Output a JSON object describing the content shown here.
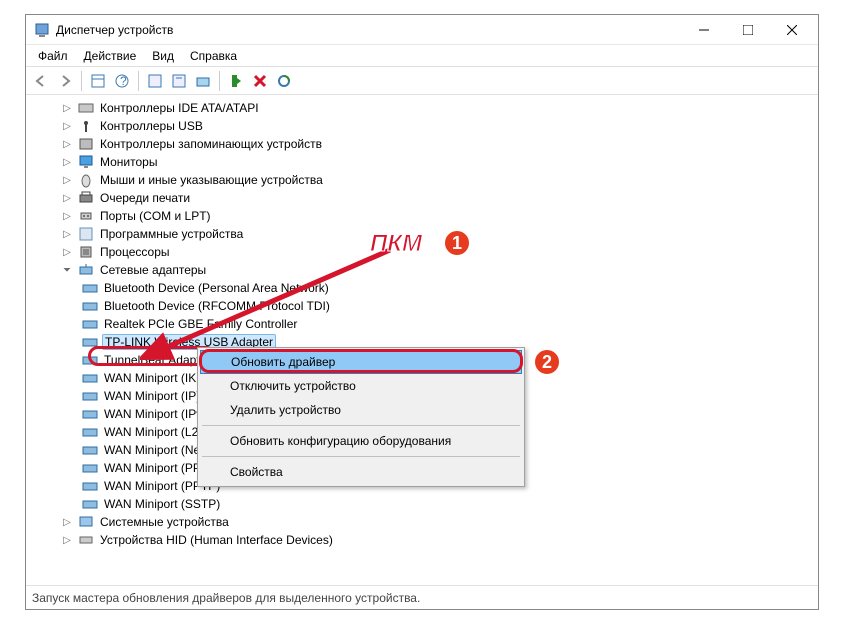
{
  "window": {
    "title": "Диспетчер устройств"
  },
  "menu": {
    "file": "Файл",
    "action": "Действие",
    "view": "Вид",
    "help": "Справка"
  },
  "categories": {
    "ide": "Контроллеры IDE ATA/ATAPI",
    "usb": "Контроллеры USB",
    "storage": "Контроллеры запоминающих устройств",
    "monitors": "Мониторы",
    "mice": "Мыши и иные указывающие устройства",
    "printqueues": "Очереди печати",
    "ports": "Порты (COM и LPT)",
    "software": "Программные устройства",
    "processors": "Процессоры",
    "network": "Сетевые адаптеры",
    "system": "Системные устройства",
    "hid": "Устройства HID (Human Interface Devices)"
  },
  "network_items": {
    "bt_pan": "Bluetooth Device (Personal Area Network)",
    "bt_rfcomm": "Bluetooth Device (RFCOMM Protocol TDI)",
    "realtek": "Realtek PCIe GBE Family Controller",
    "tplink": "TP-LINK Wireless USB Adapter",
    "tunnelbear": "TunnelBear Adapter V9",
    "wan_ike": "WAN Miniport (IKEv2)",
    "wan_ip": "WAN Miniport (IP)",
    "wan_ipv6": "WAN Miniport (IPv6)",
    "wan_l2tp": "WAN Miniport (L2TP)",
    "wan_netmon": "WAN Miniport (Network Monitor)",
    "wan_pppoe": "WAN Miniport (PPPOE)",
    "wan_pptp": "WAN Miniport (PPTP)",
    "wan_sstp": "WAN Miniport (SSTP)"
  },
  "context_menu": {
    "update": "Обновить драйвер",
    "disable": "Отключить устройство",
    "uninstall": "Удалить устройство",
    "scan": "Обновить конфигурацию оборудования",
    "properties": "Свойства"
  },
  "status": "Запуск мастера обновления драйверов для выделенного устройства.",
  "annotation": {
    "pkm": "ПКМ",
    "badge1": "1",
    "badge2": "2"
  }
}
